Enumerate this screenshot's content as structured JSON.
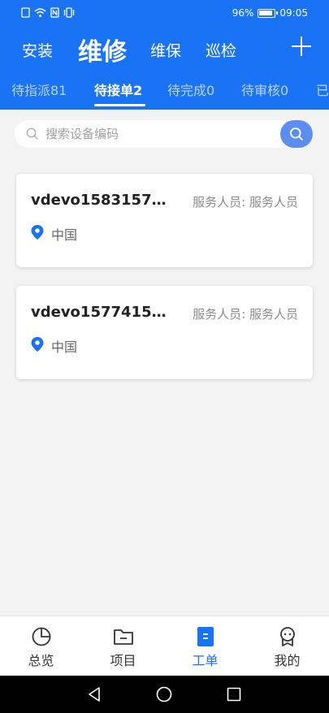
{
  "status_bar": {
    "battery": "96%",
    "time": "09:05"
  },
  "main_tabs": [
    {
      "label": "安装"
    },
    {
      "label": "维修",
      "active": true
    },
    {
      "label": "维保"
    },
    {
      "label": "巡检"
    }
  ],
  "sub_tabs": [
    {
      "label": "待指派81"
    },
    {
      "label": "待接单2",
      "active": true
    },
    {
      "label": "待完成0"
    },
    {
      "label": "待审核0"
    },
    {
      "label": "已"
    }
  ],
  "search": {
    "placeholder": "搜索设备编码"
  },
  "cards": [
    {
      "code": "vdevo15831571...",
      "staff": "服务人员: 服务人员",
      "location": "中国"
    },
    {
      "code": "vdevo15774151...",
      "staff": "服务人员: 服务人员",
      "location": "中国"
    }
  ],
  "bottom_nav": [
    {
      "label": "总览",
      "icon": "pie-chart-icon"
    },
    {
      "label": "项目",
      "icon": "folder-icon"
    },
    {
      "label": "工单",
      "icon": "work-order-icon",
      "active": true
    },
    {
      "label": "我的",
      "icon": "profile-icon"
    }
  ],
  "colors": {
    "primary": "#1a73f5",
    "search_button": "#5b8ef0",
    "inactive_subtab": "#b9d3fb",
    "background": "#f3f3f3"
  }
}
